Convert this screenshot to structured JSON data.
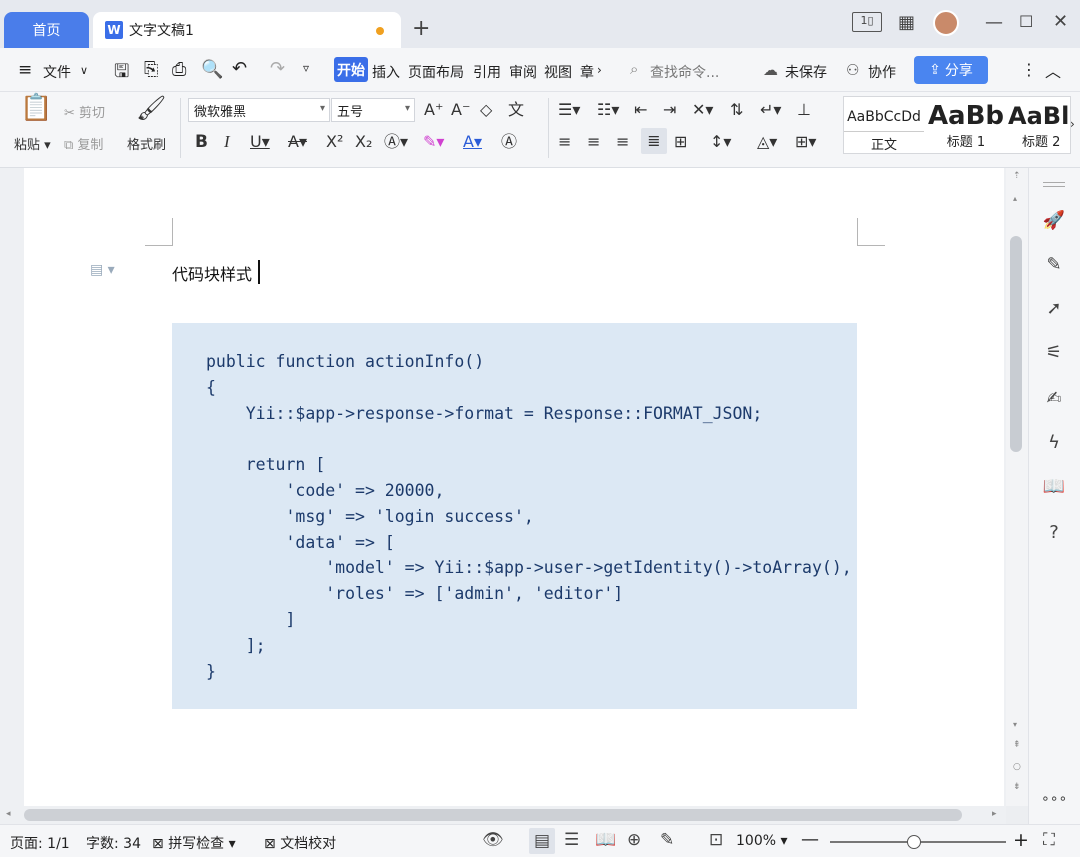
{
  "window": {
    "home_tab": "首页",
    "doc_tab": "文字文稿1",
    "new_tab": "+",
    "accent": "#4a7dea"
  },
  "ribbon": {
    "menu_label": "文件",
    "tabs": [
      "开始",
      "插入",
      "页面布局",
      "引用",
      "审阅",
      "视图",
      "章"
    ],
    "search_placeholder": "查找命令...",
    "unsaved": "未保存",
    "collab": "协作",
    "share": "分享"
  },
  "toolbar": {
    "paste": "粘贴",
    "cut": "剪切",
    "copy": "复制",
    "format_painter": "格式刷",
    "font_family": "微软雅黑",
    "font_size": "五号",
    "styles": [
      {
        "preview": "AaBbCcDd",
        "name": "正文"
      },
      {
        "preview": "AaBb",
        "name": "标题 1"
      },
      {
        "preview": "AaBl",
        "name": "标题 2"
      }
    ]
  },
  "document": {
    "heading": "代码块样式",
    "code_lines": [
      "public function actionInfo()",
      "{",
      "    Yii::$app->response->format = Response::FORMAT_JSON;",
      "",
      "    return [",
      "        'code' => 20000,",
      "        'msg' => 'login success',",
      "        'data' => [",
      "            'model' => Yii::$app->user->getIdentity()->toArray(),",
      "            'roles' => ['admin', 'editor']",
      "        ]",
      "    ];",
      "}"
    ],
    "code_bg": "#dce8f4",
    "code_color": "#1c3a6b"
  },
  "status": {
    "page": "页面: 1/1",
    "words": "字数: 34",
    "spell": "拼写检查",
    "proof": "文档校对",
    "zoom": "100%",
    "zoom_fraction": 0.48
  }
}
